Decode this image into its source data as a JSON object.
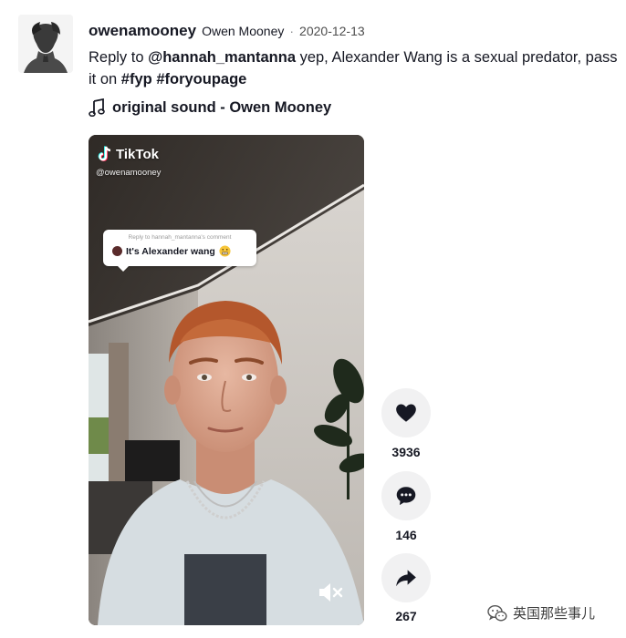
{
  "post": {
    "username": "owenamooney",
    "nickname": "Owen Mooney",
    "separator": "·",
    "date": "2020-12-13",
    "caption": {
      "prefix": "Reply to ",
      "mention": "@hannah_mantanna",
      "text": " yep, Alexander Wang is a sexual predator, pass it on ",
      "hashtag1": "#fyp",
      "space": " ",
      "hashtag2": "#foryoupage"
    },
    "music_label": "original sound - Owen Mooney"
  },
  "video": {
    "logo_text": "TikTok",
    "handle": "@owenamooney",
    "reply_to_label": "Reply to hannah_mantanna's comment",
    "comment_text": "It's Alexander wang"
  },
  "actions": {
    "likes": "3936",
    "comments": "146",
    "shares": "267"
  },
  "watermark": {
    "text": "英国那些事儿"
  },
  "colors": {
    "text": "#161823",
    "action_bg": "#f1f1f2",
    "muted": "#8a8b91"
  },
  "icons": [
    "music-note-icon",
    "tiktok-logo-icon",
    "heart-icon",
    "comment-icon",
    "share-icon",
    "mute-icon",
    "wechat-icon",
    "grimace-emoji-icon"
  ]
}
